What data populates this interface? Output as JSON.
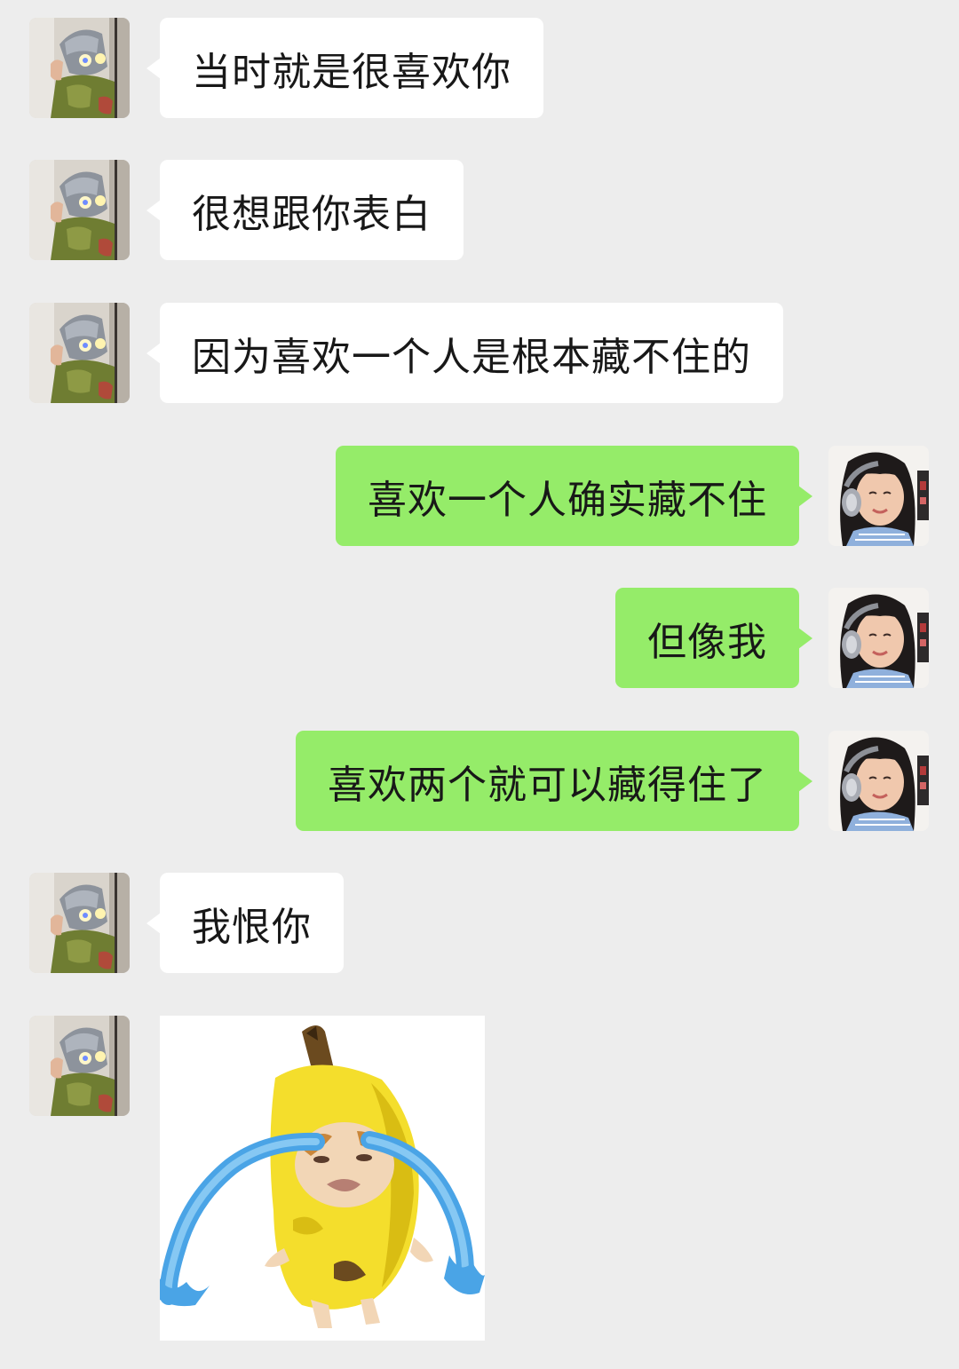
{
  "messages": [
    {
      "side": "left",
      "text": "当时就是很喜欢你"
    },
    {
      "side": "left",
      "text": "很想跟你表白"
    },
    {
      "side": "left",
      "text": "因为喜欢一个人是根本藏不住的"
    },
    {
      "side": "right",
      "text": "喜欢一个人确实藏不住"
    },
    {
      "side": "right",
      "text": "但像我"
    },
    {
      "side": "right",
      "text": "喜欢两个就可以藏得住了"
    },
    {
      "side": "left",
      "text": "我恨你"
    },
    {
      "side": "left",
      "type": "sticker",
      "sticker": "crying-banana-cat"
    }
  ],
  "colors": {
    "background": "#ededed",
    "incoming_bubble": "#ffffff",
    "outgoing_bubble": "#95ec69",
    "text": "#181818"
  }
}
